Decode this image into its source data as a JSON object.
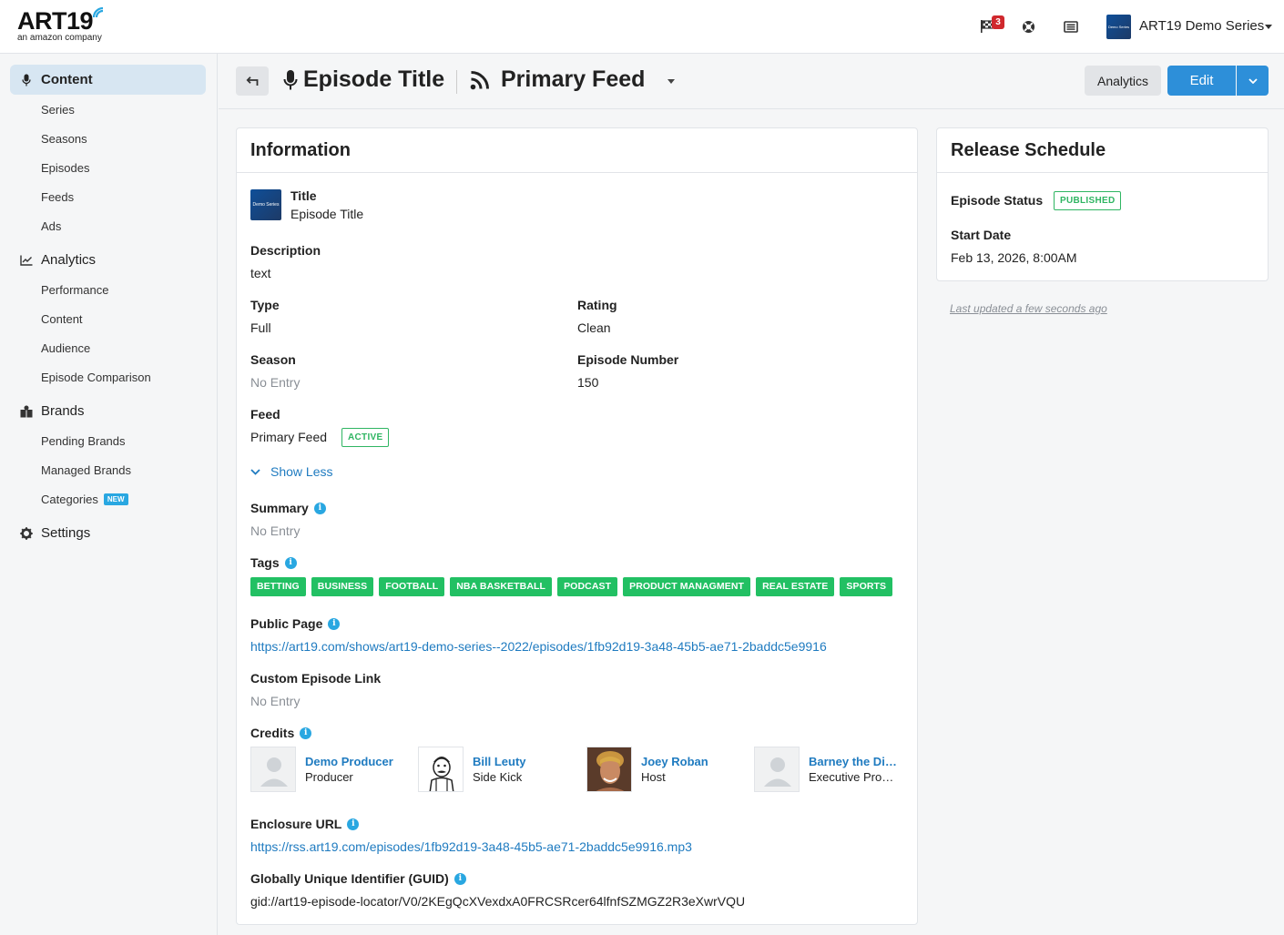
{
  "brand": {
    "logo_text": "ART19",
    "logo_sub": "an amazon company"
  },
  "topbar": {
    "notification_count": "3",
    "series_thumb_text": "Demo Series",
    "series_name": "ART19 Demo Series"
  },
  "sidebar": {
    "content": {
      "label": "Content",
      "items": [
        "Series",
        "Seasons",
        "Episodes",
        "Feeds",
        "Ads"
      ]
    },
    "analytics": {
      "label": "Analytics",
      "items": [
        "Performance",
        "Content",
        "Audience",
        "Episode Comparison"
      ]
    },
    "brands": {
      "label": "Brands",
      "items": [
        "Pending Brands",
        "Managed Brands",
        "Categories"
      ],
      "new_badge": "NEW"
    },
    "settings": {
      "label": "Settings"
    }
  },
  "header": {
    "episode_title": "Episode Title",
    "feed_title": "Primary Feed",
    "analytics_label": "Analytics",
    "edit_label": "Edit"
  },
  "info": {
    "heading": "Information",
    "thumb_text": "Demo Series",
    "title_label": "Title",
    "title_value": "Episode Title",
    "description_label": "Description",
    "description_value": "text",
    "type_label": "Type",
    "type_value": "Full",
    "rating_label": "Rating",
    "rating_value": "Clean",
    "season_label": "Season",
    "season_value": "No Entry",
    "episode_number_label": "Episode Number",
    "episode_number_value": "150",
    "feed_label": "Feed",
    "feed_value": "Primary Feed",
    "feed_status": "ACTIVE",
    "show_less": "Show Less",
    "summary_label": "Summary",
    "summary_value": "No Entry",
    "tags_label": "Tags",
    "tags": [
      "BETTING",
      "BUSINESS",
      "FOOTBALL",
      "NBA BASKETBALL",
      "PODCAST",
      "PRODUCT MANAGMENT",
      "REAL ESTATE",
      "SPORTS"
    ],
    "public_page_label": "Public Page",
    "public_page_url": "https://art19.com/shows/art19-demo-series--2022/episodes/1fb92d19-3a48-45b5-ae71-2baddc5e9916",
    "custom_link_label": "Custom Episode Link",
    "custom_link_value": "No Entry",
    "credits_label": "Credits",
    "credits": [
      {
        "name": "Demo Producer",
        "role": "Producer"
      },
      {
        "name": "Bill Leuty",
        "role": "Side Kick"
      },
      {
        "name": "Joey Roban",
        "role": "Host"
      },
      {
        "name": "Barney the Dinosaur",
        "role": "Executive Producer"
      }
    ],
    "enclosure_label": "Enclosure URL",
    "enclosure_url": "https://rss.art19.com/episodes/1fb92d19-3a48-45b5-ae71-2baddc5e9916.mp3",
    "guid_label": "Globally Unique Identifier (GUID)",
    "guid_value": "gid://art19-episode-locator/V0/2KEgQcXVexdxA0FRCSRcer64lfnfSZMGZ2R3eXwrVQU"
  },
  "release": {
    "heading": "Release Schedule",
    "status_label": "Episode Status",
    "status_value": "PUBLISHED",
    "start_date_label": "Start Date",
    "start_date_value": "Feb 13, 2026, 8:00AM",
    "last_updated": "Last updated a few seconds ago"
  },
  "colors": {
    "accent": "#2d8fd9",
    "link": "#1f7bc0",
    "tag_green": "#22c063",
    "status_green": "#2fb562",
    "info_blue": "#29a7e1",
    "badge_red": "#d0282d"
  }
}
